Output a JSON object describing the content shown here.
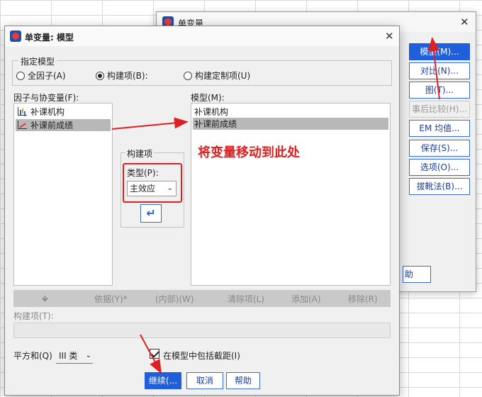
{
  "back_dialog": {
    "title": "单变量",
    "buttons": [
      {
        "label": "模型(M)...",
        "state": "primary"
      },
      {
        "label": "对比(N)...",
        "state": "normal"
      },
      {
        "label": "图(T)...",
        "state": "normal"
      },
      {
        "label": "事后比较(H)...",
        "state": "disabled"
      },
      {
        "label": "EM 均值...",
        "state": "normal"
      },
      {
        "label": "保存(S)...",
        "state": "normal"
      },
      {
        "label": "选项(O)...",
        "state": "normal"
      },
      {
        "label": "拔靴法(B)...",
        "state": "normal"
      }
    ],
    "partial_button_label": "助"
  },
  "front_dialog": {
    "title": "单变量: 模型",
    "specify_model_legend": "指定模型",
    "radios": [
      {
        "label": "全因子(A)",
        "checked": false
      },
      {
        "label": "构建项(B):",
        "checked": true
      },
      {
        "label": "构建定制项(U)",
        "checked": false
      }
    ],
    "factors_label": "因子与协变量(F):",
    "factors": [
      {
        "label": "补课机构",
        "icon": "scale-variable-icon",
        "selected": false
      },
      {
        "label": "补课前成绩",
        "icon": "line-variable-icon",
        "selected": true
      }
    ],
    "model_label": "模型(M):",
    "model_items": [
      {
        "label": "补课机构",
        "selected": false
      },
      {
        "label": "补课前成绩",
        "selected": true
      }
    ],
    "build_terms_legend": "构建项",
    "type_label": "类型(P):",
    "type_value": "主效应",
    "move_button_glyph": "↵",
    "annotation": "将变量移动到此处",
    "toolbar": {
      "down_glyph": "🡻",
      "by": "依据(Y)*",
      "within": "(内部)(W)",
      "clear": "清除项(L)",
      "add": "添加(A)",
      "remove": "移除(R)"
    },
    "build_term_label": "构建项(T):",
    "build_term_value": "",
    "sum_of_squares_label": "平方和(Q)",
    "sum_of_squares_value": "III 类",
    "include_intercept_label": "在模型中包括截距(I)",
    "include_intercept_checked": true,
    "buttons": {
      "continue": "继续(...",
      "cancel": "取消",
      "help": "帮助"
    }
  },
  "colors": {
    "accent": "#1f5fdc",
    "annotation": "#e02020",
    "selection": "#b8b8b8"
  }
}
